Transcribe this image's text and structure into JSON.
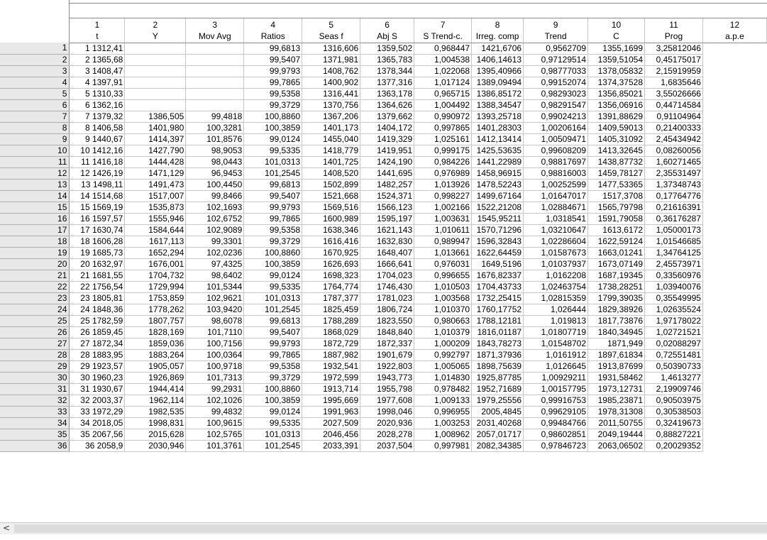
{
  "columns": [
    {
      "num": "1",
      "name": "t"
    },
    {
      "num": "2",
      "name": "Y"
    },
    {
      "num": "3",
      "name": "Mov Avg"
    },
    {
      "num": "4",
      "name": "Ratios"
    },
    {
      "num": "5",
      "name": "Seas f"
    },
    {
      "num": "6",
      "name": "Abj S"
    },
    {
      "num": "7",
      "name": "S Trend-c."
    },
    {
      "num": "8",
      "name": "Irreg. comp"
    },
    {
      "num": "9",
      "name": "Trend"
    },
    {
      "num": "10",
      "name": "C"
    },
    {
      "num": "11",
      "name": "Prog"
    },
    {
      "num": "12",
      "name": "a.p.e"
    }
  ],
  "rows": [
    [
      "1",
      "1 1312,41",
      "",
      "",
      "99,6813",
      "1316,606",
      "1359,502",
      "0,968447",
      "1421,6706",
      "0,9562709",
      "1355,1699",
      "3,25812046"
    ],
    [
      "2",
      "2 1365,68",
      "",
      "",
      "99,5407",
      "1371,981",
      "1365,783",
      "1,004538",
      "1406,14613",
      "0,97129514",
      "1359,51054",
      "0,45175017"
    ],
    [
      "3",
      "3 1408,47",
      "",
      "",
      "99,9793",
      "1408,762",
      "1378,344",
      "1,022068",
      "1395,40966",
      "0,98777033",
      "1378,05832",
      "2,15919959"
    ],
    [
      "4",
      "4 1397,91",
      "",
      "",
      "99,7865",
      "1400,902",
      "1377,316",
      "1,017124",
      "1389,09494",
      "0,99152074",
      "1374,37528",
      "1,6835646"
    ],
    [
      "5",
      "5 1310,33",
      "",
      "",
      "99,5358",
      "1316,441",
      "1363,178",
      "0,965715",
      "1386,85172",
      "0,98293023",
      "1356,85021",
      "3,55026666"
    ],
    [
      "6",
      "6 1362,16",
      "",
      "",
      "99,3729",
      "1370,756",
      "1364,626",
      "1,004492",
      "1388,34547",
      "0,98291547",
      "1356,06916",
      "0,44714584"
    ],
    [
      "7",
      "7 1379,32",
      "1386,505",
      "99,4818",
      "100,8860",
      "1367,206",
      "1379,662",
      "0,990972",
      "1393,25718",
      "0,99024213",
      "1391,88629",
      "0,91104964"
    ],
    [
      "8",
      "8 1406,58",
      "1401,980",
      "100,3281",
      "100,3859",
      "1401,173",
      "1404,172",
      "0,997865",
      "1401,28303",
      "1,00206164",
      "1409,59013",
      "0,21400333"
    ],
    [
      "9",
      "9 1440,67",
      "1414,397",
      "101,8576",
      "99,0124",
      "1455,040",
      "1419,329",
      "1,025161",
      "1412,13414",
      "1,00509471",
      "1405,31092",
      "2,45434942"
    ],
    [
      "10",
      "10 1412,16",
      "1427,790",
      "98,9053",
      "99,5335",
      "1418,779",
      "1419,951",
      "0,999175",
      "1425,53635",
      "0,99608209",
      "1413,32645",
      "0,08260056"
    ],
    [
      "11",
      "11 1416,18",
      "1444,428",
      "98,0443",
      "101,0313",
      "1401,725",
      "1424,190",
      "0,984226",
      "1441,22989",
      "0,98817697",
      "1438,87732",
      "1,60271465"
    ],
    [
      "12",
      "12 1426,19",
      "1471,129",
      "96,9453",
      "101,2545",
      "1408,520",
      "1441,695",
      "0,976989",
      "1458,96915",
      "0,98816003",
      "1459,78127",
      "2,35531497"
    ],
    [
      "13",
      "13 1498,11",
      "1491,473",
      "100,4450",
      "99,6813",
      "1502,899",
      "1482,257",
      "1,013926",
      "1478,52243",
      "1,00252599",
      "1477,53365",
      "1,37348743"
    ],
    [
      "14",
      "14 1514,68",
      "1517,007",
      "99,8466",
      "99,5407",
      "1521,668",
      "1524,371",
      "0,998227",
      "1499,67164",
      "1,01647017",
      "1517,3708",
      "0,17764776"
    ],
    [
      "15",
      "15 1569,19",
      "1535,873",
      "102,1693",
      "99,9793",
      "1569,516",
      "1566,123",
      "1,002166",
      "1522,21208",
      "1,02884671",
      "1565,79798",
      "0,21616391"
    ],
    [
      "16",
      "16 1597,57",
      "1555,946",
      "102,6752",
      "99,7865",
      "1600,989",
      "1595,197",
      "1,003631",
      "1545,95211",
      "1,0318541",
      "1591,79058",
      "0,36176287"
    ],
    [
      "17",
      "17 1630,74",
      "1584,644",
      "102,9089",
      "99,5358",
      "1638,346",
      "1621,143",
      "1,010611",
      "1570,71296",
      "1,03210647",
      "1613,6172",
      "1,05000173"
    ],
    [
      "18",
      "18 1606,28",
      "1617,113",
      "99,3301",
      "99,3729",
      "1616,416",
      "1632,830",
      "0,989947",
      "1596,32843",
      "1,02286604",
      "1622,59124",
      "1,01546685"
    ],
    [
      "19",
      "19 1685,73",
      "1652,294",
      "102,0236",
      "100,8860",
      "1670,925",
      "1648,407",
      "1,013661",
      "1622,64459",
      "1,01587673",
      "1663,01241",
      "1,34764125"
    ],
    [
      "20",
      "20 1632,97",
      "1676,001",
      "97,4325",
      "100,3859",
      "1626,693",
      "1666,641",
      "0,976031",
      "1649,5196",
      "1,01037937",
      "1673,07149",
      "2,45573971"
    ],
    [
      "21",
      "21 1681,55",
      "1704,732",
      "98,6402",
      "99,0124",
      "1698,323",
      "1704,023",
      "0,996655",
      "1676,82337",
      "1,0162208",
      "1687,19345",
      "0,33560976"
    ],
    [
      "22",
      "22 1756,54",
      "1729,994",
      "101,5344",
      "99,5335",
      "1764,774",
      "1746,430",
      "1,010503",
      "1704,43733",
      "1,02463754",
      "1738,28251",
      "1,03940076"
    ],
    [
      "23",
      "23 1805,81",
      "1753,859",
      "102,9621",
      "101,0313",
      "1787,377",
      "1781,023",
      "1,003568",
      "1732,25415",
      "1,02815359",
      "1799,39035",
      "0,35549995"
    ],
    [
      "24",
      "24 1848,36",
      "1778,262",
      "103,9420",
      "101,2545",
      "1825,459",
      "1806,724",
      "1,010370",
      "1760,17752",
      "1,026444",
      "1829,38926",
      "1,02635524"
    ],
    [
      "25",
      "25 1782,59",
      "1807,757",
      "98,6078",
      "99,6813",
      "1788,289",
      "1823,550",
      "0,980663",
      "1788,12181",
      "1,019813",
      "1817,73876",
      "1,97178022"
    ],
    [
      "26",
      "26 1859,45",
      "1828,169",
      "101,7110",
      "99,5407",
      "1868,029",
      "1848,840",
      "1,010379",
      "1816,01187",
      "1,01807719",
      "1840,34945",
      "1,02721521"
    ],
    [
      "27",
      "27 1872,34",
      "1859,036",
      "100,7156",
      "99,9793",
      "1872,729",
      "1872,337",
      "1,000209",
      "1843,78273",
      "1,01548702",
      "1871,949",
      "0,02088297"
    ],
    [
      "28",
      "28 1883,95",
      "1883,264",
      "100,0364",
      "99,7865",
      "1887,982",
      "1901,679",
      "0,992797",
      "1871,37936",
      "1,0161912",
      "1897,61834",
      "0,72551481"
    ],
    [
      "29",
      "29 1923,57",
      "1905,057",
      "100,9718",
      "99,5358",
      "1932,541",
      "1922,803",
      "1,005065",
      "1898,75639",
      "1,0126645",
      "1913,87699",
      "0,50390733"
    ],
    [
      "30",
      "30 1960,23",
      "1926,869",
      "101,7313",
      "99,3729",
      "1972,599",
      "1943,773",
      "1,014830",
      "1925,87785",
      "1,00929211",
      "1931,58462",
      "1,4613277"
    ],
    [
      "31",
      "31 1930,67",
      "1944,414",
      "99,2931",
      "100,8860",
      "1913,714",
      "1955,798",
      "0,978482",
      "1952,71689",
      "1,00157795",
      "1973,12731",
      "2,19909746"
    ],
    [
      "32",
      "32 2003,37",
      "1962,114",
      "102,1026",
      "100,3859",
      "1995,669",
      "1977,608",
      "1,009133",
      "1979,25556",
      "0,99916753",
      "1985,23871",
      "0,90503975"
    ],
    [
      "33",
      "33 1972,29",
      "1982,535",
      "99,4832",
      "99,0124",
      "1991,963",
      "1998,046",
      "0,996955",
      "2005,4845",
      "0,99629105",
      "1978,31308",
      "0,30538503"
    ],
    [
      "34",
      "34 2018,05",
      "1998,831",
      "100,9615",
      "99,5335",
      "2027,509",
      "2020,936",
      "1,003253",
      "2031,40268",
      "0,99484766",
      "2011,50755",
      "0,32419673"
    ],
    [
      "35",
      "35 2067,56",
      "2015,628",
      "102,5765",
      "101,0313",
      "2046,456",
      "2028,278",
      "1,008962",
      "2057,01717",
      "0,98602851",
      "2049,19444",
      "0,88827221"
    ],
    [
      "36",
      "36 2058,9",
      "2030,946",
      "101,3761",
      "101,2545",
      "2033,391",
      "2037,504",
      "0,997981",
      "2082,34385",
      "0,97846723",
      "2063,06502",
      "0,20029352"
    ]
  ],
  "scrollbar": {
    "left_arrow": "<"
  }
}
